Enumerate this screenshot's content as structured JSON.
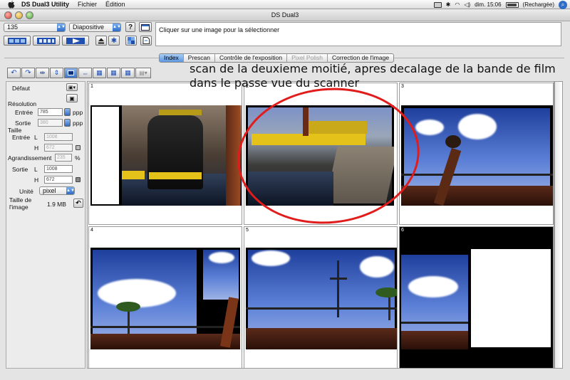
{
  "menubar": {
    "app_name": "DS Dual3 Utility",
    "menus": [
      "Fichier",
      "Édition"
    ],
    "clock": "dim. 15:06",
    "battery": "(Rechargée)"
  },
  "window": {
    "title": "DS Dual3"
  },
  "toolbar": {
    "film_format": "135",
    "film_type": "Diapositive",
    "message": "Cliquer sur une image pour la sélectionner"
  },
  "tabs": [
    {
      "label": "Index",
      "state": "active"
    },
    {
      "label": "Prescan",
      "state": "normal"
    },
    {
      "label": "Contrôle de l'exposition",
      "state": "normal"
    },
    {
      "label": "Pixel Polish",
      "state": "disabled"
    },
    {
      "label": "Correction de l'image",
      "state": "normal"
    }
  ],
  "settings": {
    "preset": "Défaut",
    "resolution_label": "Résolution",
    "input_label": "Entrée",
    "input_value": "785",
    "output_label": "Sortie",
    "output_value": "380",
    "unit_ppp": "ppp",
    "size_label": "Taille",
    "size_input_label": "Entrée",
    "L": "L",
    "H": "H",
    "size_in_L": "1008",
    "size_in_H": "672",
    "enlarge_label": "Agrandissement",
    "enlarge_value": "235",
    "percent": "%",
    "size_out_label": "Sortie",
    "size_out_L": "1008",
    "size_out_H": "672",
    "unit_label": "Unité",
    "unit_value": "pixel",
    "image_size_label_1": "Taille de",
    "image_size_label_2": "l'image",
    "image_size_value": "1.9 MB"
  },
  "frames": [
    "1",
    "2",
    "3",
    "4",
    "5",
    "6"
  ],
  "annotation": "scan de la deuxieme moitié, apres decalage de la bande de film dans le passe vue du scanner",
  "colors": {
    "annotation_circle": "#e21b1b",
    "tab_active": "#5d97df",
    "accent": "#2f6cc6"
  }
}
